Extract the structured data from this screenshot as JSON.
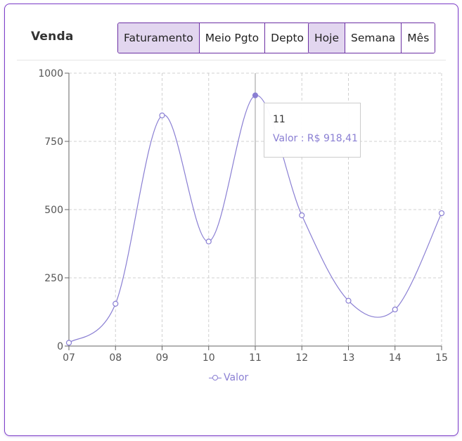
{
  "header": {
    "title": "Venda",
    "metric_tabs": [
      {
        "label": "Faturamento",
        "active": true
      },
      {
        "label": "Meio Pgto",
        "active": false
      },
      {
        "label": "Depto",
        "active": false
      }
    ],
    "period_tabs": [
      {
        "label": "Hoje",
        "active": true
      },
      {
        "label": "Semana",
        "active": false
      },
      {
        "label": "Mês",
        "active": false
      }
    ]
  },
  "tooltip": {
    "label": "11",
    "value_text": "Valor : R$ 918,41"
  },
  "colors": {
    "accent": "#8a7fd3",
    "border": "#7d3fc8",
    "active_tab": "#e2d6ef"
  },
  "chart_data": {
    "type": "line",
    "categories": [
      "07",
      "08",
      "09",
      "10",
      "11",
      "12",
      "13",
      "14",
      "15"
    ],
    "series": [
      {
        "name": "Valor",
        "values": [
          12,
          155,
          845,
          383,
          918.41,
          479,
          166,
          134,
          487
        ]
      }
    ],
    "ylim": [
      0,
      1000
    ],
    "yticks": [
      0,
      250,
      500,
      750,
      1000
    ],
    "grid": true,
    "legend": "bottom",
    "highlighted_category": "11"
  }
}
